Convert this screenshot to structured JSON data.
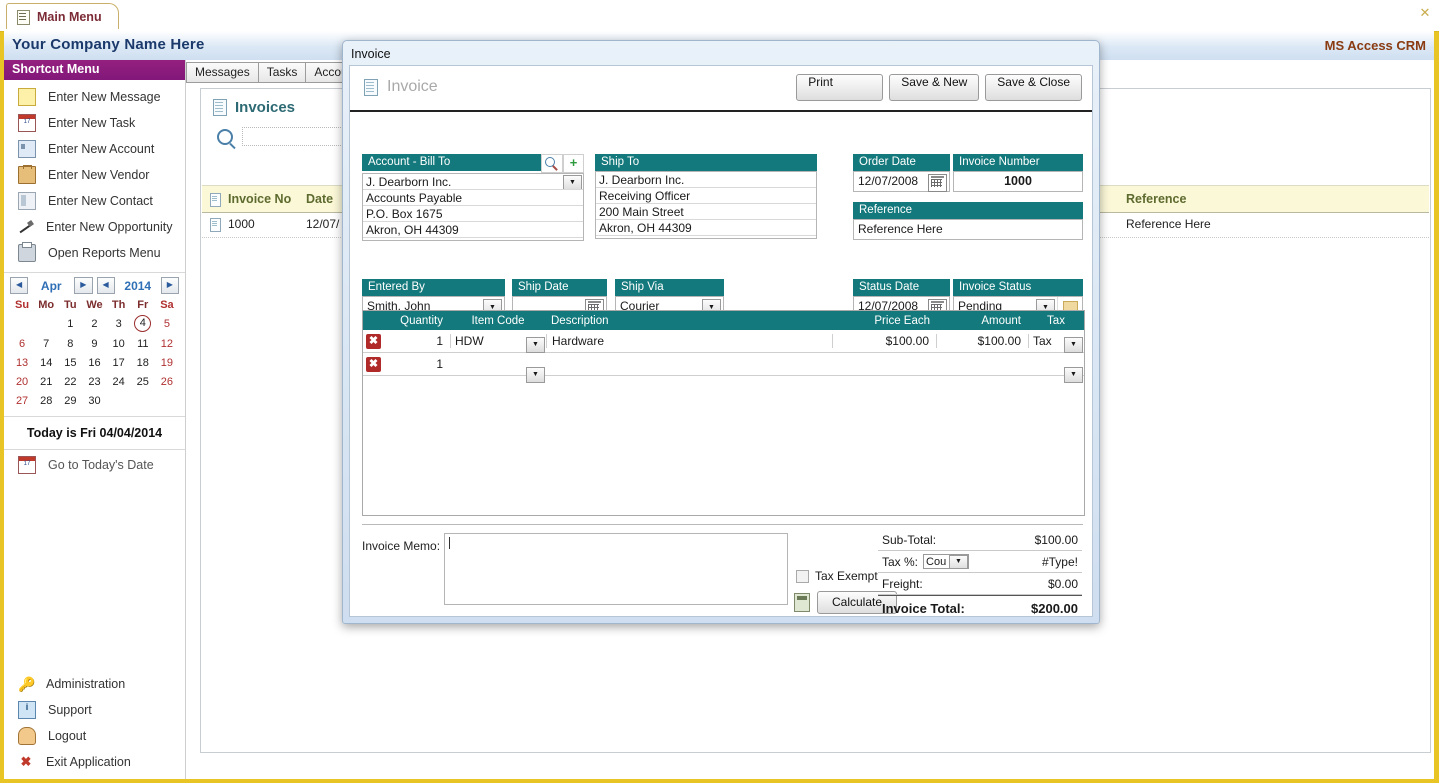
{
  "window": {
    "tab_label": "Main Menu",
    "tab_icon": "document-icon",
    "close_icon": "✕",
    "company_name": "Your Company Name Here",
    "app_name": "MS Access CRM"
  },
  "sidebar": {
    "header": "Shortcut Menu",
    "items": [
      {
        "label": "Enter New Message",
        "icon": "note-icon"
      },
      {
        "label": "Enter New Task",
        "icon": "calendar-icon"
      },
      {
        "label": "Enter New Account",
        "icon": "contact-card-icon"
      },
      {
        "label": "Enter New Vendor",
        "icon": "briefcase-icon"
      },
      {
        "label": "Enter New Contact",
        "icon": "contact-book-icon"
      },
      {
        "label": "Enter New Opportunity",
        "icon": "pen-icon"
      },
      {
        "label": "Open Reports Menu",
        "icon": "printer-icon"
      }
    ],
    "calendar": {
      "month": "Apr",
      "year": "2014",
      "prev_month_icon": "◀",
      "next_month_icon": "▶",
      "prev_year_icon": "◀",
      "next_year_icon": "▶",
      "daynames": [
        "Su",
        "Mo",
        "Tu",
        "We",
        "Th",
        "Fr",
        "Sa"
      ],
      "weeks": [
        [
          "",
          "",
          "1",
          "2",
          "3",
          "4",
          "5"
        ],
        [
          "6",
          "7",
          "8",
          "9",
          "10",
          "11",
          "12"
        ],
        [
          "13",
          "14",
          "15",
          "16",
          "17",
          "18",
          "19"
        ],
        [
          "20",
          "21",
          "22",
          "23",
          "24",
          "25",
          "26"
        ],
        [
          "27",
          "28",
          "29",
          "30",
          "",
          "",
          ""
        ]
      ],
      "today_number": "4",
      "today_text": "Today is Fri 04/04/2014",
      "go_today_label": "Go to Today's Date",
      "go_today_icon": "calendar-icon"
    },
    "bottom_items": [
      {
        "label": "Administration",
        "icon": "key-icon"
      },
      {
        "label": "Support",
        "icon": "info-icon"
      },
      {
        "label": "Logout",
        "icon": "user-icon"
      },
      {
        "label": "Exit Application",
        "icon": "exit-icon"
      }
    ]
  },
  "main": {
    "tabs": [
      "Messages",
      "Tasks",
      "Accounts"
    ],
    "panel_title": "Invoices",
    "panel_icon": "document-icon",
    "search_icon": "search-icon",
    "search_value": "",
    "search_placeholder": "",
    "columns": [
      "Invoice No",
      "Date",
      "Reference"
    ],
    "rows": [
      {
        "invoice_no": "1000",
        "date": "12/07/",
        "reference": "Reference Here"
      }
    ]
  },
  "modal": {
    "title": "Invoice",
    "heading": "Invoice",
    "heading_icon": "document-icon",
    "buttons": {
      "print": "Print",
      "save_new": "Save & New",
      "save_close": "Save & Close"
    },
    "bill_to": {
      "header": "Account - Bill To",
      "search_icon": "search-icon",
      "add_icon": "plus-icon",
      "dropdown_icon": "chevron-down-icon",
      "lines": [
        "J. Dearborn Inc.",
        "Accounts Payable",
        "P.O. Box 1675",
        "Akron, OH  44309",
        ""
      ]
    },
    "ship_to": {
      "header": "Ship To",
      "lines": [
        "J. Dearborn Inc.",
        "Receiving Officer",
        "200 Main Street",
        "Akron, OH  44309",
        ""
      ]
    },
    "order_date": {
      "header": "Order Date",
      "value": "12/07/2008",
      "picker_icon": "calendar-icon"
    },
    "invoice_number": {
      "header": "Invoice Number",
      "value": "1000"
    },
    "reference": {
      "header": "Reference",
      "value": "Reference Here"
    },
    "entered_by": {
      "header": "Entered By",
      "value": "Smith, John",
      "dropdown_icon": "chevron-down-icon"
    },
    "ship_date": {
      "header": "Ship Date",
      "value": "",
      "picker_icon": "calendar-icon"
    },
    "ship_via": {
      "header": "Ship Via",
      "value": "Courier",
      "dropdown_icon": "chevron-down-icon"
    },
    "status_date": {
      "header": "Status Date",
      "value": "12/07/2008",
      "picker_icon": "calendar-icon"
    },
    "invoice_status": {
      "header": "Invoice Status",
      "value": "Pending",
      "dropdown_icon": "chevron-down-icon",
      "note_icon": "folder-icon"
    },
    "line_items": {
      "columns": [
        "Quantity",
        "Item Code",
        "Description",
        "Price Each",
        "Amount",
        "Tax"
      ],
      "delete_icon": "delete-icon",
      "rows": [
        {
          "quantity": "1",
          "item_code": "HDW",
          "description": "Hardware",
          "price_each": "$100.00",
          "amount": "$100.00",
          "tax": "Tax"
        },
        {
          "quantity": "1",
          "item_code": "",
          "description": "",
          "price_each": "",
          "amount": "",
          "tax": ""
        }
      ]
    },
    "memo": {
      "label": "Invoice Memo:",
      "value": ""
    },
    "tax_exempt": {
      "label": "Tax Exempt",
      "checked": false
    },
    "calculate": {
      "label": "Calculate",
      "icon": "calculator-icon"
    },
    "totals": [
      {
        "label": "Sub-Total:",
        "value": "$100.00"
      },
      {
        "label": "Tax %:",
        "select_value": "Cou",
        "value": "#Type!"
      },
      {
        "label": "Freight:",
        "value": "$0.00"
      },
      {
        "label": "Invoice Total:",
        "value": "$200.00"
      }
    ]
  },
  "colors": {
    "teal_header": "#14797c",
    "purple_header": "#8a1f7c",
    "frame_yellow": "#e8c425",
    "brand_blue": "#1b3a6b",
    "crm_orange": "#8a3b12",
    "grid_yellow": "#fbf8d8"
  }
}
